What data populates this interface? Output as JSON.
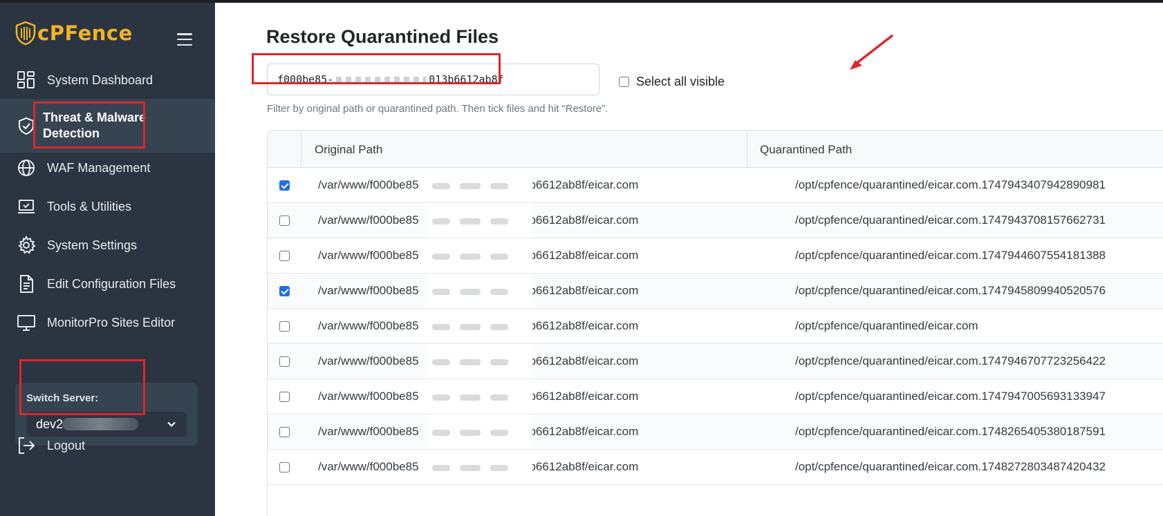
{
  "brand": {
    "name": "cPFence",
    "accent": "#f2b227"
  },
  "sidebar": {
    "menu_icon": "hamburger-icon",
    "items": [
      {
        "label": "System Dashboard",
        "icon": "dashboard-icon"
      },
      {
        "label": "Threat & Malware Detection",
        "icon": "shield-check-icon",
        "active": true
      },
      {
        "label": "WAF Management",
        "icon": "globe-icon"
      },
      {
        "label": "Tools & Utilities",
        "icon": "laptop-check-icon"
      },
      {
        "label": "System Settings",
        "icon": "gear-icon"
      },
      {
        "label": "Edit Configuration Files",
        "icon": "file-text-icon"
      },
      {
        "label": "MonitorPro Sites Editor",
        "icon": "monitor-icon"
      }
    ],
    "switch_server": {
      "label": "Switch Server:",
      "value": "dev2"
    },
    "logout": {
      "label": "Logout",
      "icon": "logout-icon"
    }
  },
  "main": {
    "title": "Restore Quarantined Files",
    "search": {
      "value_start": "f000be85-",
      "value_end": "013b6612ab8f"
    },
    "select_all_label": "Select all visible",
    "hint": "Filter by original path or quarantined path. Then tick files and hit “Restore”.",
    "table": {
      "headers": [
        "Original Path",
        "Quarantined Path"
      ],
      "rows": [
        {
          "checked": true,
          "original_start": "/var/www/f000be85",
          "original_end": "13b6612ab8f/eicar.com",
          "quarantined": "/opt/cpfence/quarantined/eicar.com.1747943407942890981"
        },
        {
          "checked": false,
          "original_start": "/var/www/f000be85",
          "original_end": "13b6612ab8f/eicar.com",
          "quarantined": "/opt/cpfence/quarantined/eicar.com.1747943708157662731"
        },
        {
          "checked": false,
          "original_start": "/var/www/f000be85",
          "original_end": "13b6612ab8f/eicar.com",
          "quarantined": "/opt/cpfence/quarantined/eicar.com.1747944607554181388"
        },
        {
          "checked": true,
          "original_start": "/var/www/f000be85",
          "original_end": "13b6612ab8f/eicar.com",
          "quarantined": "/opt/cpfence/quarantined/eicar.com.1747945809940520576"
        },
        {
          "checked": false,
          "original_start": "/var/www/f000be85",
          "original_end": "13b6612ab8f/eicar.com",
          "quarantined": "/opt/cpfence/quarantined/eicar.com"
        },
        {
          "checked": false,
          "original_start": "/var/www/f000be85",
          "original_end": "13b6612ab8f/eicar.com",
          "quarantined": "/opt/cpfence/quarantined/eicar.com.1747946707723256422"
        },
        {
          "checked": false,
          "original_start": "/var/www/f000be85",
          "original_end": "13b6612ab8f/eicar.com",
          "quarantined": "/opt/cpfence/quarantined/eicar.com.1747947005693133947"
        },
        {
          "checked": false,
          "original_start": "/var/www/f000be85",
          "original_end": "13b6612ab8f/eicar.com",
          "quarantined": "/opt/cpfence/quarantined/eicar.com.1748265405380187591"
        },
        {
          "checked": false,
          "original_start": "/var/www/f000be85",
          "original_end": "13b6612ab8f/eicar.com",
          "quarantined": "/opt/cpfence/quarantined/eicar.com.1748272803487420432"
        }
      ]
    }
  }
}
